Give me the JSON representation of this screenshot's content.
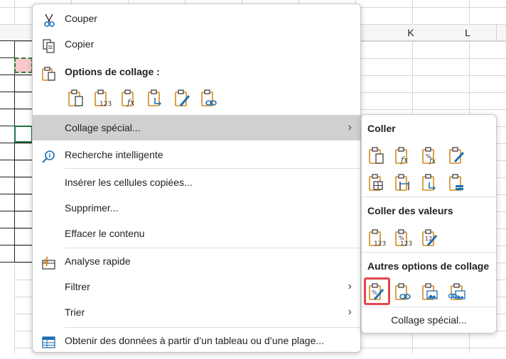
{
  "sheet": {
    "columns": [
      "K",
      "L"
    ]
  },
  "menu": {
    "items": [
      {
        "label": "Couper",
        "icon": "scissors-icon"
      },
      {
        "label": "Copier",
        "icon": "copy-icon"
      },
      {
        "label": "Options de collage :",
        "icon": "paste-icon"
      },
      {
        "label": "Collage spécial...",
        "icon": "",
        "submenu": true
      },
      {
        "label": "Recherche intelligente",
        "icon": "smart-lookup-icon"
      },
      {
        "label": "Insérer les cellules copiées...",
        "icon": ""
      },
      {
        "label": "Supprimer...",
        "icon": ""
      },
      {
        "label": "Effacer le contenu",
        "icon": ""
      },
      {
        "label": "Analyse rapide",
        "icon": "quick-analysis-icon"
      },
      {
        "label": "Filtrer",
        "icon": "",
        "submenu": true
      },
      {
        "label": "Trier",
        "icon": "",
        "submenu": true
      },
      {
        "label": "Obtenir des données à partir d’un tableau ou d’une plage...",
        "icon": "table-icon"
      }
    ],
    "paste_options": [
      "paste-icon",
      "paste-values-icon",
      "paste-formulas-icon",
      "paste-transpose-icon",
      "paste-formatting-icon",
      "paste-link-icon"
    ]
  },
  "submenu": {
    "section_paste": "Coller",
    "section_values": "Coller des valeurs",
    "section_other": "Autres options de collage",
    "paste_icons": [
      "paste-icon",
      "paste-formulas-icon",
      "paste-formulas-number-format-icon",
      "paste-keep-source-formatting-icon",
      "paste-no-borders-icon",
      "paste-keep-column-widths-icon",
      "paste-transpose-icon",
      "paste-merge-conditional-icon"
    ],
    "values_icons": [
      "paste-values-icon",
      "paste-values-number-format-icon",
      "paste-values-source-format-icon"
    ],
    "other_icons": [
      "paste-formatting-icon",
      "paste-link-icon",
      "paste-picture-icon",
      "paste-linked-picture-icon"
    ],
    "footer_link": "Collage spécial..."
  }
}
